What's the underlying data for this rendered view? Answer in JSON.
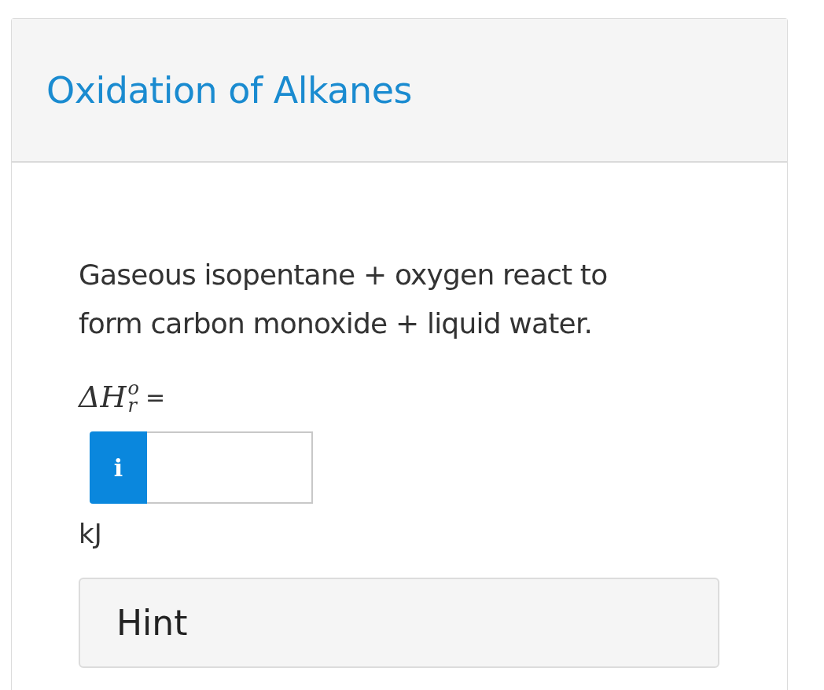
{
  "card": {
    "title": "Oxidation of Alkanes"
  },
  "question": {
    "text": "Gaseous isopentane + oxygen react to form carbon monoxide + liquid water."
  },
  "formula": {
    "symbol": "ΔH",
    "subscript": "r",
    "superscript": "o",
    "equals": "="
  },
  "answer": {
    "info_label": "i",
    "unit": "kJ"
  },
  "hint": {
    "label": "Hint"
  }
}
